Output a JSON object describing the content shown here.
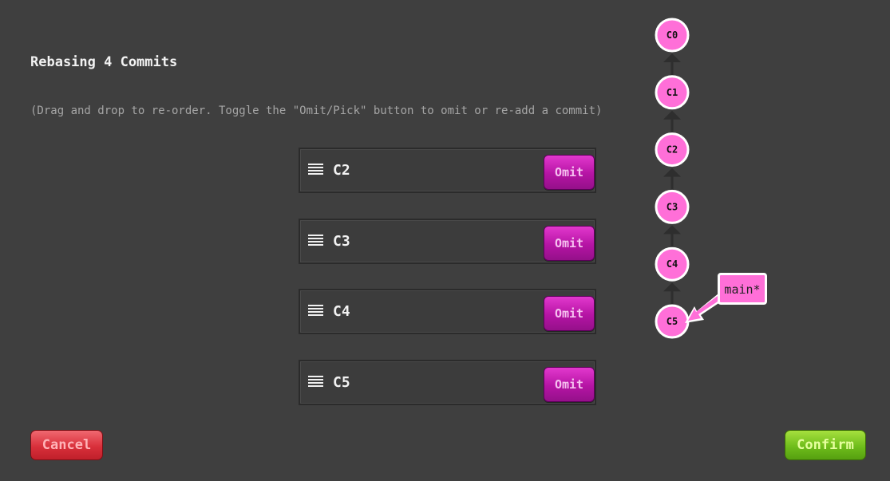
{
  "dialog": {
    "title": "Rebasing 4 Commits",
    "hint": "(Drag and drop to re-order. Toggle the \"Omit/Pick\" button to omit or re-add a commit)"
  },
  "commits": [
    {
      "label": "C2",
      "button": "Omit"
    },
    {
      "label": "C3",
      "button": "Omit"
    },
    {
      "label": "C4",
      "button": "Omit"
    },
    {
      "label": "C5",
      "button": "Omit"
    }
  ],
  "actions": {
    "cancel": "Cancel",
    "confirm": "Confirm"
  },
  "tree": {
    "nodes": [
      "C0",
      "C1",
      "C2",
      "C3",
      "C4",
      "C5"
    ],
    "branch": {
      "name": "main*",
      "target": "C5"
    }
  },
  "colors": {
    "background": "#3f3f3f",
    "node_fill": "#ff6fd8",
    "omit_button": "#c61cb3",
    "cancel_button": "#d9303b",
    "confirm_button": "#6fbd1b"
  }
}
